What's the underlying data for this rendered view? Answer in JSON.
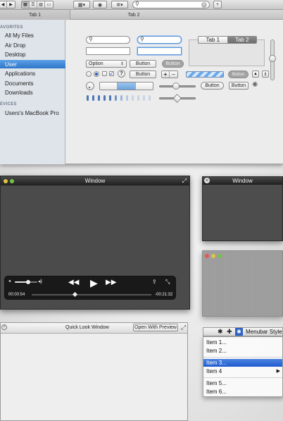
{
  "toolbar": {
    "search_placeholder": "",
    "plus_label": "+",
    "nav_back": "◀",
    "nav_forward": "▶"
  },
  "tabs": [
    {
      "label": "Tab 1"
    },
    {
      "label": "Tab 2"
    }
  ],
  "sidebar": {
    "favorites_header": "AVORITES",
    "devices_header": "EVICES",
    "items": [
      {
        "label": "All My Files"
      },
      {
        "label": "Air Drop"
      },
      {
        "label": "Desktop"
      },
      {
        "label": "User",
        "selected": true
      },
      {
        "label": "Applications"
      },
      {
        "label": "Documents"
      },
      {
        "label": "Downloads"
      }
    ],
    "devices": [
      {
        "label": "Users's MacBook Pro"
      }
    ]
  },
  "controls": {
    "popup_option": "Option",
    "button1": "Button",
    "button_disabled": "Button",
    "button2": "Button",
    "button3": "Button",
    "button_pill_disabled": "Button",
    "button_round1": "Button",
    "button_round2": "Button",
    "help": "?",
    "plus": "+",
    "minus": "−",
    "seg_tab1": "Tab 1",
    "seg_tab2": "Tab 2"
  },
  "video_window": {
    "title": "Window",
    "time_elapsed": "00:00:54",
    "time_remaining": "-00:21:32",
    "progress": 0.36,
    "volume": 0.6
  },
  "small_window": {
    "title": "Window"
  },
  "quicklook": {
    "title": "Quick Look Window",
    "open_button": "Open With Preview"
  },
  "menu": {
    "title": "Menubar Style",
    "items": [
      {
        "label": "Item 1..."
      },
      {
        "label": "Item 2..."
      },
      {
        "label": "Item 3...",
        "selected": true
      },
      {
        "label": "Item 4",
        "submenu": true
      },
      {
        "label": "Item 5..."
      },
      {
        "label": "Item 6..."
      }
    ]
  },
  "colors": {
    "selection_blue": "#2f76c9",
    "menu_highlight": "#1f5bcf",
    "dark_window": "#4b4b4b"
  }
}
